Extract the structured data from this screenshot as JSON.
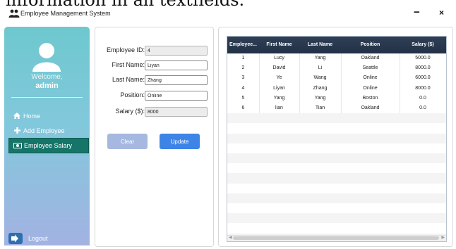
{
  "page_caption": "information in all textfields.",
  "window": {
    "title": "Employee Management System",
    "minimize_label": "−",
    "close_label": "×"
  },
  "sidebar": {
    "welcome": "Welcome,",
    "username": "admin",
    "items": [
      {
        "label": "Home",
        "icon": "home-icon",
        "active": false
      },
      {
        "label": "Add Employee",
        "icon": "plus-icon",
        "active": false
      },
      {
        "label": "Employee Salary",
        "icon": "money-icon",
        "active": true
      }
    ],
    "logout_label": "Logout"
  },
  "form": {
    "employee_id": {
      "label": "Employee ID:",
      "value": "4"
    },
    "first_name": {
      "label": "First Name:",
      "value": "Liyan"
    },
    "last_name": {
      "label": "Last Name:",
      "value": "Zhang"
    },
    "position": {
      "label": "Position:",
      "value": "Online"
    },
    "salary": {
      "label": "Salary ($):",
      "value": "8000"
    },
    "clear_label": "Clear",
    "update_label": "Update"
  },
  "table": {
    "columns": [
      "Employee...",
      "First Name",
      "Last Name",
      "Position",
      "Salary ($)"
    ],
    "rows": [
      [
        "1",
        "Lucy",
        "Yang",
        "Oakland",
        "5000.0"
      ],
      [
        "2",
        "David",
        "Li",
        "Seattle",
        "8000.0"
      ],
      [
        "3",
        "Ye",
        "Wang",
        "Online",
        "6000.0"
      ],
      [
        "4",
        "Liyan",
        "Zhang",
        "Online",
        "8000.0"
      ],
      [
        "5",
        "Yang",
        "Yang",
        "Boston",
        "0.0"
      ],
      [
        "6",
        "lian",
        "Tian",
        "Oakland",
        "0.0"
      ]
    ]
  },
  "colors": {
    "sidebar_top": "#6ec8ce",
    "sidebar_bottom": "#a3b2e2",
    "active_item": "#157568",
    "update_button": "#3d84e6",
    "clear_button": "#a6b7e0",
    "table_header": "#2f3f57"
  }
}
